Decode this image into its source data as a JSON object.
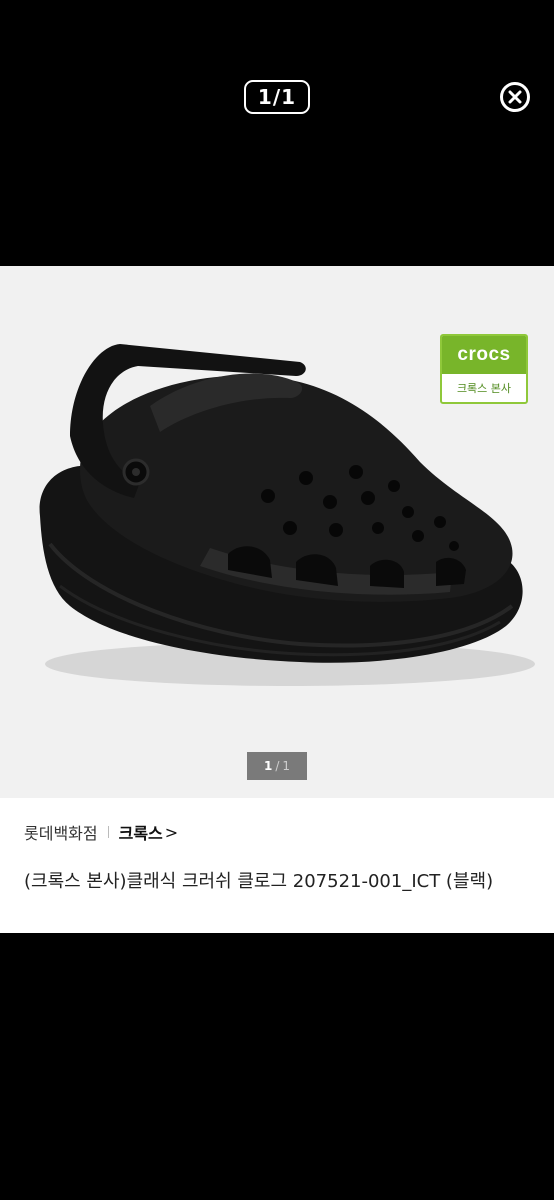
{
  "viewer": {
    "counter": "1/1"
  },
  "gallery": {
    "badge_brand": "crocs",
    "badge_subtitle": "크록스 본사",
    "indicator_current": "1",
    "indicator_separator": "/",
    "indicator_total": "1"
  },
  "product": {
    "store": "롯데백화점",
    "brand": "크록스",
    "brand_chevron": ">",
    "title": "(크록스 본사)클래식 크러쉬 클로그 207521-001_ICT (블랙)"
  },
  "icons": {
    "close": "close-icon",
    "product_image": "black-clog-shoe"
  },
  "colors": {
    "background": "#000000",
    "image_bg": "#f1f1f1",
    "badge_green": "#78b52a"
  }
}
